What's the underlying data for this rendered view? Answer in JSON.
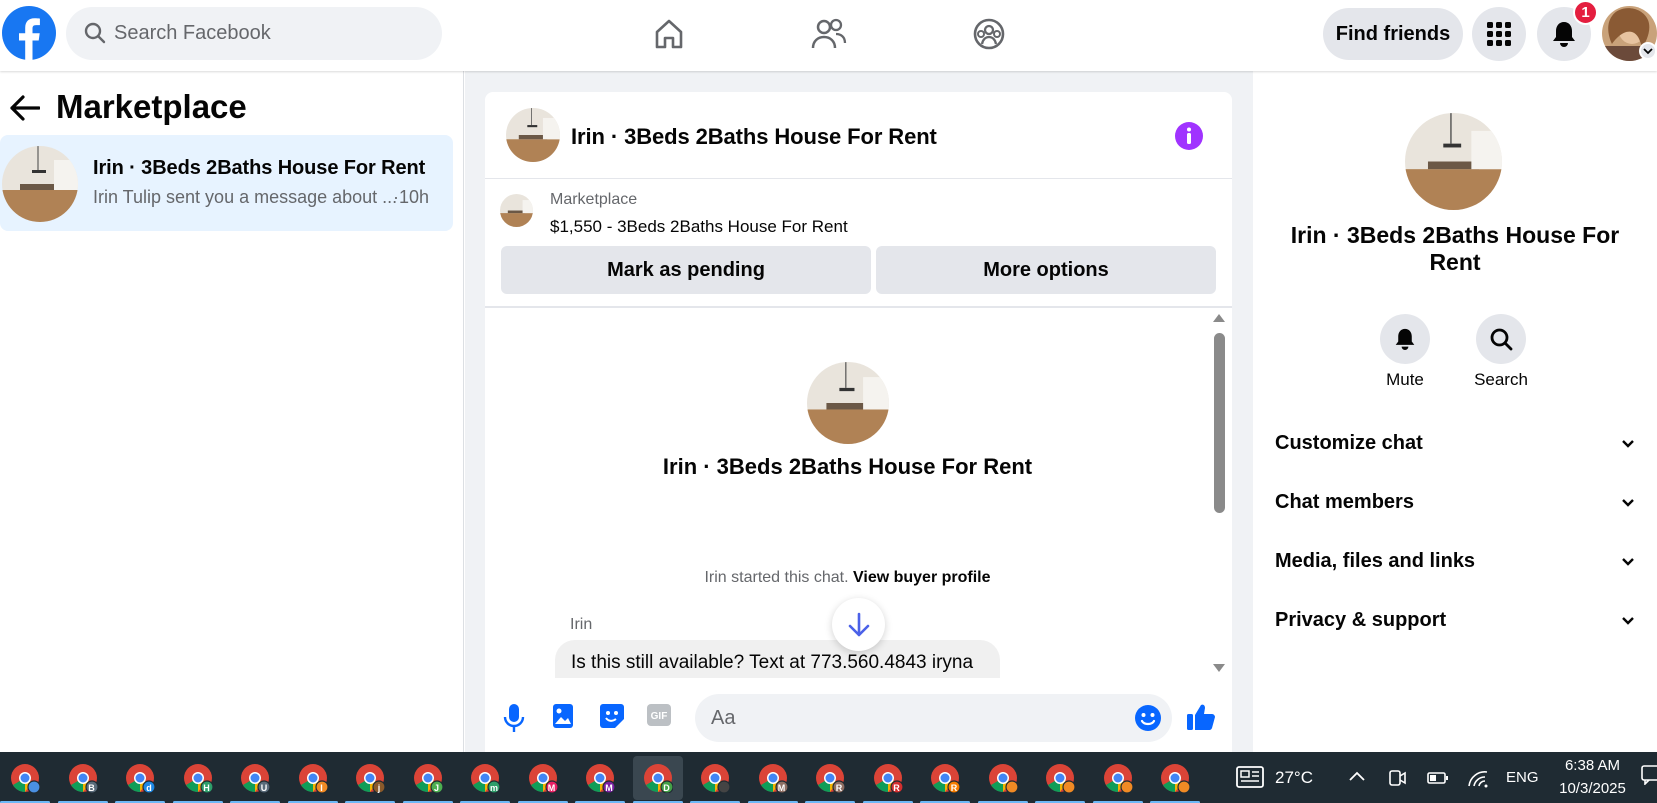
{
  "topbar": {
    "search_placeholder": "Search Facebook",
    "find_friends": "Find friends",
    "notification_count": "1",
    "brand_color": "#1877f2"
  },
  "left": {
    "title": "Marketplace",
    "conversation": {
      "name": "Irin · 3Beds 2Baths House For Rent",
      "preview": "Irin Tulip sent you a message about ...",
      "time": "·10h"
    }
  },
  "chat": {
    "header_title": "Irin · 3Beds 2Baths House For Rent",
    "listing_label": "Marketplace",
    "listing_price": "$1,550 - 3Beds 2Baths House For Rent",
    "mark_pending": "Mark as pending",
    "more_options": "More options",
    "big_title": "Irin · 3Beds 2Baths House For Rent",
    "started_text": "Irin started this chat.",
    "view_buyer": "View buyer profile",
    "sender": "Irin",
    "message": "Is this still available? Text at 773.560.4843 iryna",
    "composer_placeholder": "Aa"
  },
  "right": {
    "title": "Irin · 3Beds 2Baths House For Rent",
    "mute": "Mute",
    "search": "Search",
    "sections": [
      "Customize chat",
      "Chat members",
      "Media, files and links",
      "Privacy & support"
    ]
  },
  "taskbar": {
    "apps": [
      {
        "letter": "",
        "color": "#4a90e2"
      },
      {
        "letter": "B",
        "color": "#5a6b7a"
      },
      {
        "letter": "d",
        "color": "#1e88e5"
      },
      {
        "letter": "H",
        "color": "#2e9e6a"
      },
      {
        "letter": "U",
        "color": "#5a6b7a"
      },
      {
        "letter": "I",
        "color": "#f08a24"
      },
      {
        "letter": "j",
        "color": "#8a5a2b"
      },
      {
        "letter": "J",
        "color": "#4caf50"
      },
      {
        "letter": "m",
        "color": "#2e9e6a"
      },
      {
        "letter": "M",
        "color": "#e91e63"
      },
      {
        "letter": "M",
        "color": "#7b1fa2"
      },
      {
        "letter": "D",
        "color": "#43a047"
      },
      {
        "letter": "",
        "color": "#444444"
      },
      {
        "letter": "M",
        "color": "#8d6e63"
      },
      {
        "letter": "R",
        "color": "#8d6e63"
      },
      {
        "letter": "R",
        "color": "#d32f2f"
      },
      {
        "letter": "R",
        "color": "#f57c00"
      },
      {
        "letter": "",
        "color": "#f08a24"
      },
      {
        "letter": "",
        "color": "#f08a24"
      },
      {
        "letter": "",
        "color": "#f08a24"
      },
      {
        "letter": "",
        "color": "#f08a24"
      }
    ],
    "weather": "27°C",
    "lang": "ENG",
    "time": "6:38 AM",
    "date": "10/3/2025"
  }
}
